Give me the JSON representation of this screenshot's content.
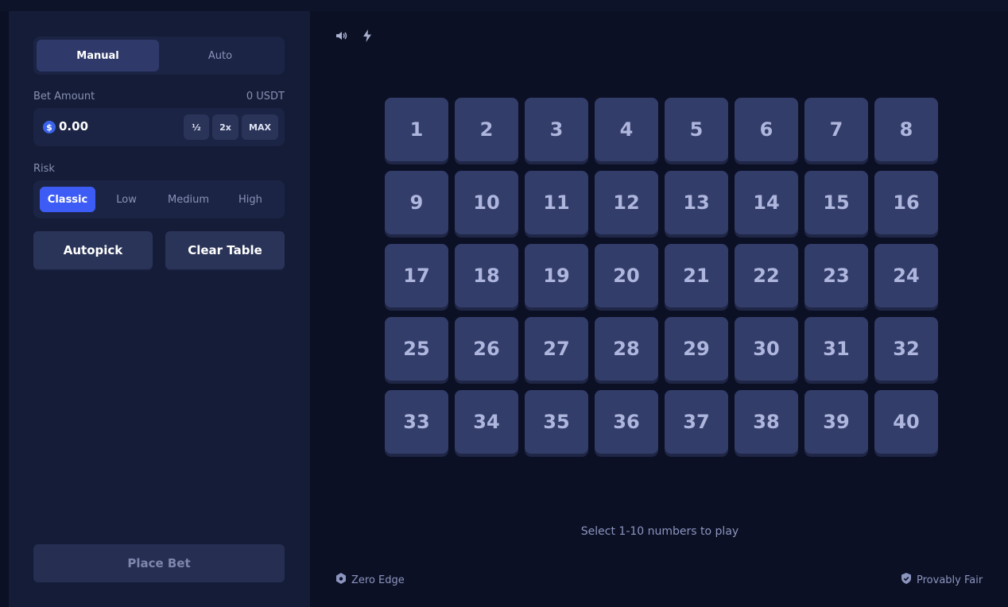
{
  "mode": {
    "tabs": [
      "Manual",
      "Auto"
    ],
    "active": "Manual"
  },
  "bet": {
    "label": "Bet Amount",
    "balance": "0 USDT",
    "currency_symbol": "$",
    "value": "0.00",
    "half_label": "½",
    "double_label": "2x",
    "max_label": "MAX"
  },
  "risk": {
    "label": "Risk",
    "options": [
      "Classic",
      "Low",
      "Medium",
      "High"
    ],
    "active": "Classic"
  },
  "actions": {
    "autopick_label": "Autopick",
    "clear_label": "Clear Table",
    "place_bet_label": "Place Bet"
  },
  "toolbar": {
    "icons": [
      "speaker-icon",
      "lightning-icon"
    ]
  },
  "board": {
    "numbers": [
      "1",
      "2",
      "3",
      "4",
      "5",
      "6",
      "7",
      "8",
      "9",
      "10",
      "11",
      "12",
      "13",
      "14",
      "15",
      "16",
      "17",
      "18",
      "19",
      "20",
      "21",
      "22",
      "23",
      "24",
      "25",
      "26",
      "27",
      "28",
      "29",
      "30",
      "31",
      "32",
      "33",
      "34",
      "35",
      "36",
      "37",
      "38",
      "39",
      "40"
    ]
  },
  "hint": "Select 1-10 numbers to play",
  "footer": {
    "left_label": "Zero Edge",
    "right_label": "Provably Fair"
  },
  "colors": {
    "accent": "#3d5cf5",
    "tile": "#333d6a",
    "panel": "#141c37",
    "background": "#0b1024"
  }
}
